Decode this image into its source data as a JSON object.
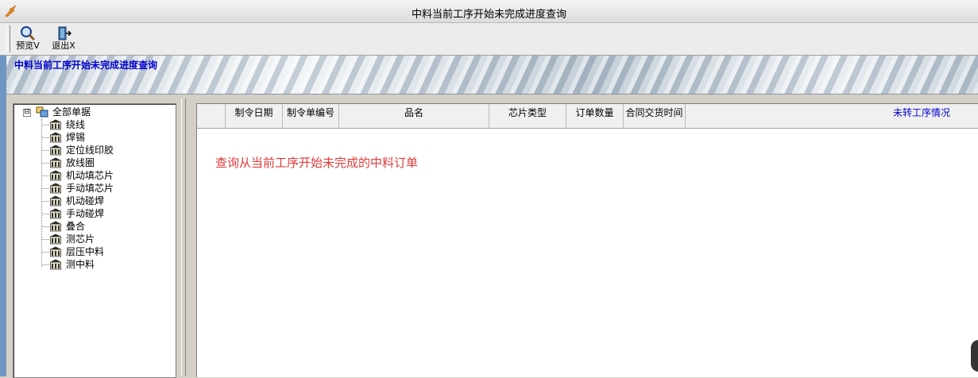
{
  "window": {
    "title": "中料当前工序开始未完成进度查询"
  },
  "toolbar": {
    "preview_label": "预览V",
    "exit_label": "退出X"
  },
  "banner": {
    "title": "中料当前工序开始未完成进度查询"
  },
  "tree": {
    "root_label": "全部单据",
    "root_expander": "⊟",
    "items": [
      "绕线",
      "焊锡",
      "定位线印胶",
      "放线圈",
      "机动填芯片",
      "手动填芯片",
      "机动碰焊",
      "手动碰焊",
      "叠合",
      "测芯片",
      "层压中料",
      "测中料"
    ]
  },
  "grid": {
    "columns": [
      "",
      "制令日期",
      "制令单编号",
      "品名",
      "芯片类型",
      "订单数量",
      "合同交货时间",
      "未转工序情况"
    ],
    "empty_message": "查询从当前工序开始未完成的中料订单"
  },
  "colors": {
    "accent_link": "#0000cc",
    "message": "#e03a3a",
    "left_edge": "#6f95c2"
  }
}
